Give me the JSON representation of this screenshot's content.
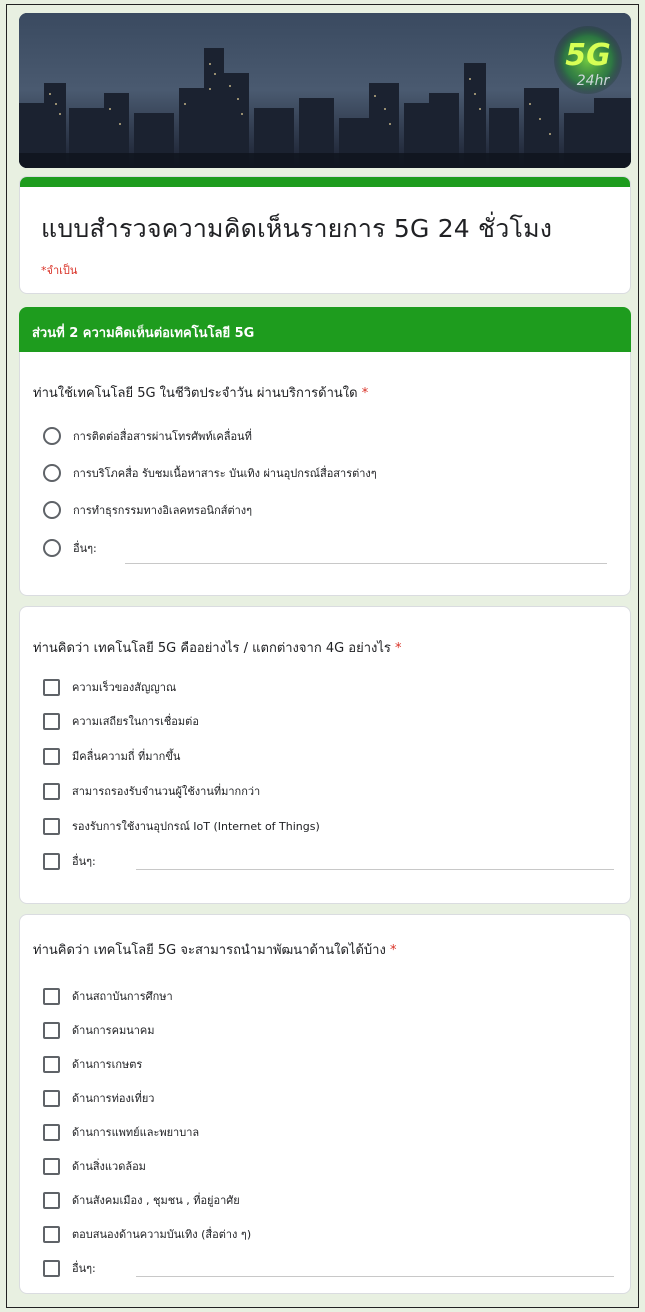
{
  "banner": {
    "logo_text": "5G",
    "logo_sub": "24hr"
  },
  "form": {
    "title": "แบบสำรวจความคิดเห็นรายการ 5G 24 ชั่วโมง",
    "required_note": "*จำเป็น"
  },
  "section": {
    "title": "ส่วนที่ 2 ความคิดเห็นต่อเทคโนโลยี 5G"
  },
  "questions": [
    {
      "title": "ท่านใช้เทคโนโลยี 5G ในชีวิตประจำวัน ผ่านบริการด้านใด",
      "required": "*",
      "type": "radio",
      "options": [
        "การติดต่อสื่อสารผ่านโทรศัพท์เคลื่อนที่",
        "การบริโภคสื่อ รับชมเนื้อหาสาระ บันเทิง ผ่านอุปกรณ์สื่อสารต่างๆ",
        "การทำธุรกรรมทางอิเลคทรอนิกส์ต่างๆ",
        "อื่นๆ:"
      ]
    },
    {
      "title": "ท่านคิดว่า เทคโนโลยี 5G คืออย่างไร / แตกต่างจาก 4G อย่างไร",
      "required": "*",
      "type": "checkbox",
      "options": [
        "ความเร็วของสัญญาณ",
        "ความเสถียรในการเชื่อมต่อ",
        "มีคลื่นความถี่ ที่มากขึ้น",
        "สามารถรองรับจำนวนผู้ใช้งานที่มากกว่า",
        "รองรับการใช้งานอุปกรณ์ IoT (Internet of Things)",
        "อื่นๆ:"
      ]
    },
    {
      "title": "ท่านคิดว่า เทคโนโลยี 5G จะสามารถนำมาพัฒนาด้านใดได้บ้าง",
      "required": "*",
      "type": "checkbox",
      "options": [
        "ด้านสถาบันการศึกษา",
        "ด้านการคมนาคม",
        "ด้านการเกษตร",
        "ด้านการท่องเที่ยว",
        "ด้านการแพทย์และพยาบาล",
        "ด้านสิ่งแวดล้อม",
        "ด้านสังคมเมือง , ชุมชน , ที่อยู่อาศัย",
        "ตอบสนองด้านความบันเทิง (สื่อต่าง ๆ)",
        "อื่นๆ:"
      ]
    }
  ],
  "colors": {
    "accent": "#1e9c1e",
    "background": "#e8f0e1",
    "required": "#d93025"
  }
}
